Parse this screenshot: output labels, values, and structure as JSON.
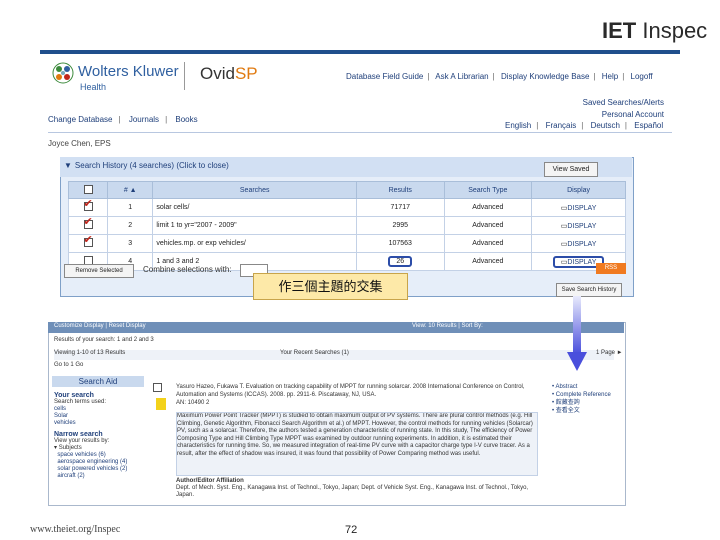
{
  "branding": {
    "iet": "IET",
    "inspec": "Inspec",
    "wolters_kluwer": "Wolters Kluwer",
    "health": "Health",
    "ovid": "Ovid",
    "sp": "SP"
  },
  "top_links": [
    "Database Field Guide",
    "Ask A Librarian",
    "Display Knowledge Base",
    "Help",
    "Logoff"
  ],
  "right_links": [
    "Saved Searches/Alerts",
    "Personal Account"
  ],
  "languages": [
    "English",
    "Français",
    "Deutsch",
    "Español"
  ],
  "nav_links": [
    "Change Database",
    "Journals",
    "Books"
  ],
  "user_name": "Joyce Chen, EPS",
  "search_history": {
    "title": "Search History",
    "count": "(4 searches)",
    "toggle": "(Click to close)",
    "view_saved": "View Saved",
    "columns": [
      "#",
      "Searches",
      "Results",
      "Search Type",
      "Display"
    ],
    "rows": [
      {
        "checked": true,
        "num": "1",
        "query": "solar cells/",
        "results": "71717",
        "type": "Advanced",
        "display": "DISPLAY"
      },
      {
        "checked": true,
        "num": "2",
        "query": "limit 1 to yr=\"2007 - 2009\"",
        "results": "2995",
        "type": "Advanced",
        "display": "DISPLAY"
      },
      {
        "checked": true,
        "num": "3",
        "query": "vehicles.mp. or exp vehicles/",
        "results": "107563",
        "type": "Advanced",
        "display": "DISPLAY"
      },
      {
        "checked": false,
        "num": "4",
        "query": "1 and 3 and 2",
        "results": "26",
        "type": "Advanced",
        "display": "DISPLAY"
      }
    ],
    "remove_selected": "Remove Selected",
    "combine_label": "Combine selections with:",
    "rss": "RSS",
    "save_history": "Save Search History"
  },
  "callout": "作三個主題的交集",
  "results": {
    "toolbar_left": "Customize Display | Reset Display",
    "toolbar_right": "View: 10 Results | Sort By:",
    "line1": "Results of your search: 1 and 2 and 3",
    "count": "Viewing 1-10 of 13 Results",
    "recent": "Your Recent Searches (1)",
    "page": "1 Page ►",
    "go": "Go to 1 Go",
    "search_aid": "Search Aid",
    "sidebar": {
      "head1": "Your search",
      "sub1": "Search terms used:",
      "terms": [
        "cells",
        "Solar",
        "vehicles"
      ],
      "head2": "Narrow search",
      "sub2": "View your results by:",
      "subjects": "Subjects",
      "items": [
        "space vehicles (6)",
        "aerospace engineering (4)",
        "solar powered vehicles (2)",
        "aircraft (2)"
      ]
    },
    "record": {
      "citation": "Yasuro Hazeo, Fukawa T. Evaluation on tracking capability of MPPT for running solarcar. 2008 International Conference on Control, Automation and Systems (ICCAS). 2008. pp. 2911-6. Piscataway, NJ, USA.",
      "an": "AN: 10490 2",
      "abstract": "Maximum Power Point Tracker (MPPT) is studied to obtain maximum output of PV systems. There are plural control methods (e.g. Hill Climbing, Genetic Algorithm, Fibonacci Search Algorithm et al.) of MPPT. However, the control methods for running vehicles (Solarcar) PV, such as a solarcar. Therefore, the authors tested a generation characteristic of running state. In this study, The efficiency of Power Composing Type and Hill Climbing Type MPPT was examined by outdoor running experiments. In addition, it is estimated their characteristics for running time. So, we measured integration of real-time PV curve with a capacitor charge type I-V curve tracer. As a result, after the effect of shadow was insured, it was found that possibility of Power Comparing method was useful.",
      "affil_head": "Author/Editor Affiliation",
      "affil": "Dept. of Mech. Syst. Eng., Kanagawa Inst. of Technol., Tokyo, Japan; Dept. of Vehicle Syst. Eng., Kanagawa Inst. of Technol., Tokyo, Japan.",
      "links": [
        "Abstract",
        "Complete Reference",
        "館藏查詢",
        "查看全文"
      ]
    }
  },
  "footer": {
    "url": "www.theiet.org/Inspec",
    "page": "72"
  },
  "colors": {
    "accent": "#1f4f8c",
    "callout": "#fde9a8",
    "arrow": "#5b5fe0"
  }
}
